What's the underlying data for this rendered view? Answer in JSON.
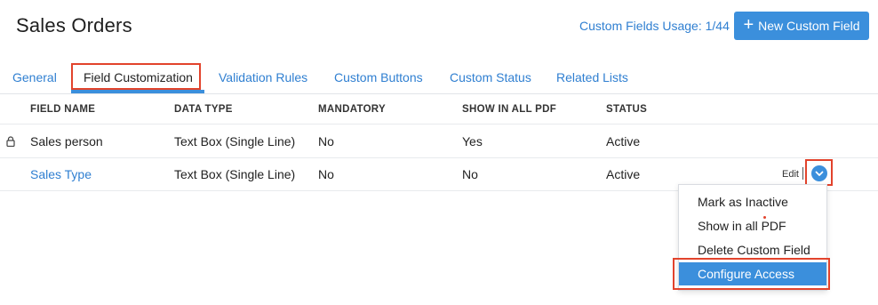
{
  "header": {
    "title": "Sales Orders",
    "usage_text": "Custom Fields Usage: 1/44",
    "new_button_icon": "plus-icon",
    "new_button_label": "New Custom Field"
  },
  "tabs": [
    {
      "label": "General"
    },
    {
      "label": "Field Customization",
      "active": true
    },
    {
      "label": "Validation Rules"
    },
    {
      "label": "Custom Buttons"
    },
    {
      "label": "Custom Status"
    },
    {
      "label": "Related Lists"
    }
  ],
  "table": {
    "columns": [
      "FIELD NAME",
      "DATA TYPE",
      "MANDATORY",
      "SHOW IN ALL PDF",
      "STATUS"
    ],
    "rows": [
      {
        "field_name": "Sales person",
        "data_type": "Text Box (Single Line)",
        "mandatory": "No",
        "show_in_all_pdf": "Yes",
        "status": "Active",
        "locked": true
      },
      {
        "field_name": "Sales Type",
        "data_type": "Text Box (Single Line)",
        "mandatory": "No",
        "show_in_all_pdf": "No",
        "status": "Active",
        "locked": false
      }
    ],
    "row_actions": {
      "edit_label": "Edit",
      "dropdown_icon": "chevron-down-icon"
    }
  },
  "dropdown_menu": {
    "items": [
      "Mark as Inactive",
      "Show in all PDF",
      "Delete Custom Field",
      "Configure Access"
    ],
    "selected": "Configure Access"
  },
  "colors": {
    "accent": "#3b8fdc",
    "link": "#2f7fd1",
    "highlight": "#e2432c"
  }
}
